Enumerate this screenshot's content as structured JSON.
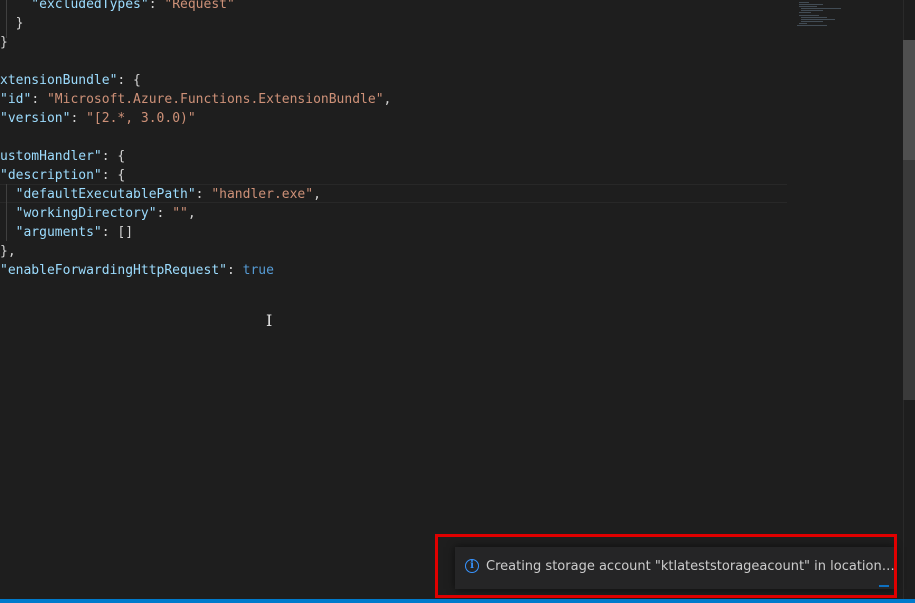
{
  "editor": {
    "lines": [
      {
        "parts": [
          {
            "t": "    \"excludedTypes\"",
            "c": "k"
          },
          {
            "t": ": ",
            "c": "p"
          },
          {
            "t": "\"Request\"",
            "c": "s"
          }
        ]
      },
      {
        "parts": [
          {
            "t": "  }",
            "c": "p"
          }
        ]
      },
      {
        "parts": [
          {
            "t": "}",
            "c": "p"
          }
        ]
      },
      {
        "parts": [
          {
            "t": "",
            "c": "p"
          }
        ]
      },
      {
        "parts": [
          {
            "t": "xtensionBundle\"",
            "c": "k"
          },
          {
            "t": ": {",
            "c": "p"
          }
        ]
      },
      {
        "parts": [
          {
            "t": "\"id\"",
            "c": "k"
          },
          {
            "t": ": ",
            "c": "p"
          },
          {
            "t": "\"Microsoft.Azure.Functions.ExtensionBundle\"",
            "c": "s"
          },
          {
            "t": ",",
            "c": "p"
          }
        ]
      },
      {
        "parts": [
          {
            "t": "\"version\"",
            "c": "k"
          },
          {
            "t": ": ",
            "c": "p"
          },
          {
            "t": "\"[2.*, 3.0.0)\"",
            "c": "s"
          }
        ]
      },
      {
        "parts": [
          {
            "t": "",
            "c": "p"
          }
        ]
      },
      {
        "parts": [
          {
            "t": "ustomHandler\"",
            "c": "k"
          },
          {
            "t": ": {",
            "c": "p"
          }
        ]
      },
      {
        "parts": [
          {
            "t": "\"description\"",
            "c": "k"
          },
          {
            "t": ": {",
            "c": "p"
          }
        ]
      },
      {
        "parts": [
          {
            "t": "  \"defaultExecutablePath\"",
            "c": "k"
          },
          {
            "t": ": ",
            "c": "p"
          },
          {
            "t": "\"handler.exe\"",
            "c": "s"
          },
          {
            "t": ",",
            "c": "p"
          }
        ]
      },
      {
        "parts": [
          {
            "t": "  \"workingDirectory\"",
            "c": "k"
          },
          {
            "t": ": ",
            "c": "p"
          },
          {
            "t": "\"\"",
            "c": "s"
          },
          {
            "t": ",",
            "c": "p"
          }
        ]
      },
      {
        "parts": [
          {
            "t": "  \"arguments\"",
            "c": "k"
          },
          {
            "t": ": []",
            "c": "p"
          }
        ]
      },
      {
        "parts": [
          {
            "t": "},",
            "c": "p"
          }
        ]
      },
      {
        "parts": [
          {
            "t": "\"enableForwardingHttpRequest\"",
            "c": "k"
          },
          {
            "t": ": ",
            "c": "p"
          },
          {
            "t": "true",
            "c": "b"
          }
        ]
      }
    ]
  },
  "notification": {
    "icon": "info-icon",
    "message": "Creating storage account \"ktlateststorageacount\" in location \"West US\"..."
  },
  "colors": {
    "editor_bg": "#1e1e1e",
    "key": "#9cdcfe",
    "string": "#ce9178",
    "boolean": "#569cd6",
    "accent": "#007acc",
    "highlight": "#e00000"
  }
}
